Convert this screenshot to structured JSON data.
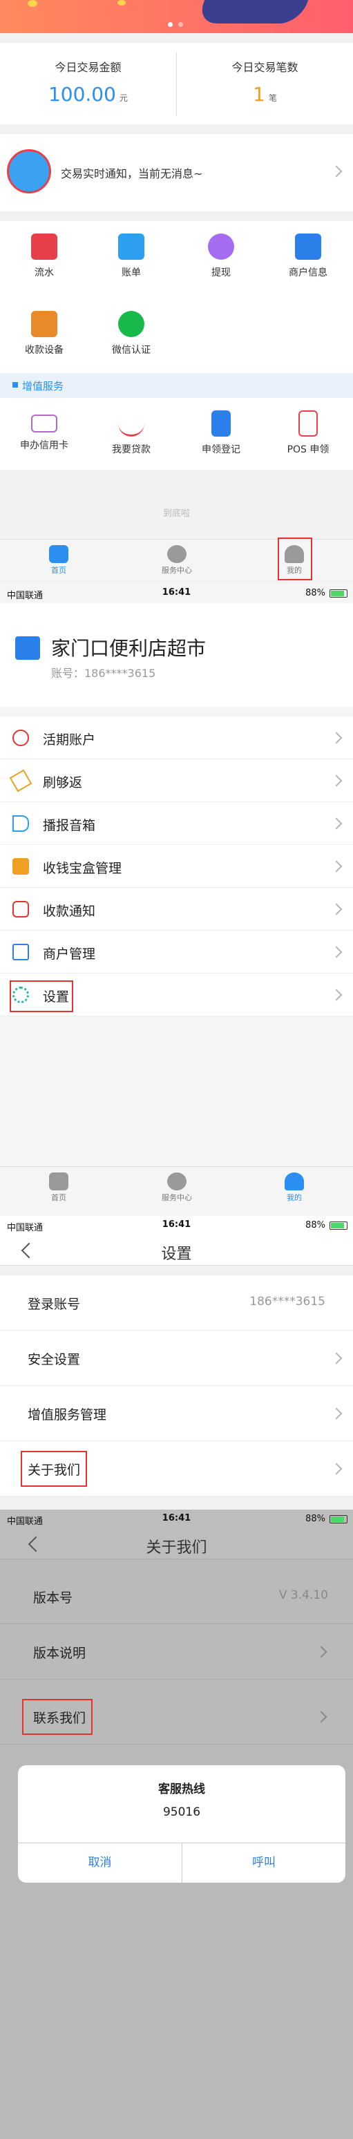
{
  "home": {
    "stats": {
      "amount_label": "今日交易金额",
      "amount_value": "100.00",
      "amount_unit": "元",
      "count_label": "今日交易笔数",
      "count_value": "1",
      "count_unit": "笔"
    },
    "notice": "交易实时通知，当前无消息~",
    "grid": [
      {
        "label": "流水",
        "icon": "ledger-icon",
        "color": "#e8404a"
      },
      {
        "label": "账单",
        "icon": "bill-icon",
        "color": "#2e9ff0"
      },
      {
        "label": "提现",
        "icon": "money-bag-icon",
        "color": "#a46cf0"
      },
      {
        "label": "商户信息",
        "icon": "store-icon",
        "color": "#2a7fe8"
      },
      {
        "label": "收款设备",
        "icon": "cash-register-icon",
        "color": "#e98a2a"
      },
      {
        "label": "微信认证",
        "icon": "wechat-check-icon",
        "color": "#17b94a"
      }
    ],
    "vas_title": "增值服务",
    "vas": [
      {
        "label": "申办信用卡",
        "icon": "credit-card-icon",
        "color": "#b068d8"
      },
      {
        "label": "我要贷款",
        "icon": "loan-hand-icon",
        "color": "#e8404a"
      },
      {
        "label": "申领登记",
        "icon": "pos-device-icon",
        "color": "#2a7fe8"
      },
      {
        "label": "POS 申领",
        "icon": "pos-terminal-icon",
        "color": "#e8404a"
      }
    ],
    "bottom_hint": "到底啦",
    "tabs": [
      "首页",
      "服务中心",
      "我的"
    ]
  },
  "status_bar": {
    "carrier": "中国联通",
    "time": "16:41",
    "battery": "88%"
  },
  "profile": {
    "store_name": "家门口便利店超市",
    "account": "账号：186****3615",
    "menu": [
      {
        "label": "活期账户",
        "icon": "yuan-circle-icon",
        "color": "#e8322f"
      },
      {
        "label": "刷够返",
        "icon": "ticket-icon",
        "color": "#f0a020"
      },
      {
        "label": "播报音箱",
        "icon": "speaker-icon",
        "color": "#2a9ff0"
      },
      {
        "label": "收钱宝盒管理",
        "icon": "cash-box-icon",
        "color": "#f0a020"
      },
      {
        "label": "收款通知",
        "icon": "message-icon",
        "color": "#e8322f"
      },
      {
        "label": "商户管理",
        "icon": "shop-icon",
        "color": "#2a7fe8"
      },
      {
        "label": "设置",
        "icon": "gear-icon",
        "color": "#22b8a8"
      }
    ],
    "tabs": [
      "首页",
      "服务中心",
      "我的"
    ]
  },
  "settings": {
    "title": "设置",
    "rows": [
      {
        "label": "登录账号",
        "value": "186****3615"
      },
      {
        "label": "安全设置"
      },
      {
        "label": "增值服务管理"
      },
      {
        "label": "关于我们"
      }
    ]
  },
  "about": {
    "title": "关于我们",
    "rows": [
      {
        "label": "版本号",
        "value": "V 3.4.10"
      },
      {
        "label": "版本说明"
      },
      {
        "label": "联系我们"
      }
    ],
    "dialog": {
      "title": "客服热线",
      "number": "95016",
      "cancel": "取消",
      "call": "呼叫"
    }
  }
}
